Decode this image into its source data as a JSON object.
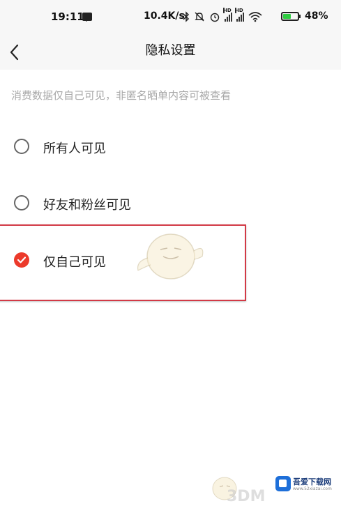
{
  "status_bar": {
    "time": "19:11",
    "net_speed": "10.4K/s",
    "battery_percent": "48%",
    "sim1_label": "HD",
    "sim2_label": "HD",
    "icons": [
      "message-icon",
      "bluetooth-icon",
      "mute-bell-icon",
      "alarm-icon",
      "signal-icon",
      "signal-icon",
      "wifi-icon",
      "battery-charging-icon"
    ]
  },
  "nav": {
    "title": "隐私设置",
    "back_icon": "chevron-left-icon"
  },
  "hint": "消费数据仅自己可见，非匿名晒单内容可被查看",
  "options": [
    {
      "label": "所有人可见",
      "selected": false
    },
    {
      "label": "好友和粉丝可见",
      "selected": false
    },
    {
      "label": "仅自己可见",
      "selected": true
    }
  ],
  "watermark": {
    "brand": "吾爱下载网",
    "url": "www.52xiazai.com",
    "faded_text": "3DM"
  },
  "colors": {
    "accent": "#ec3a2b",
    "highlight_border": "#d23a46",
    "header_bg": "#f7f7f7",
    "hint_text": "#a8a8a8"
  }
}
